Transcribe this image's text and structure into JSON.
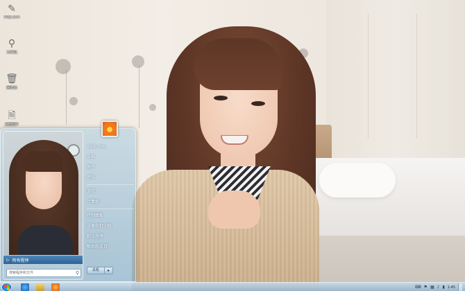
{
  "desktop": {
    "icons": [
      {
        "label": "Xieji.com",
        "icon": "pen-icon"
      },
      {
        "label": "计算机",
        "icon": "computer-icon"
      },
      {
        "label": "回收站",
        "icon": "recycle-bin-icon"
      },
      {
        "label": "桌面图片",
        "icon": "file-icon"
      }
    ]
  },
  "start_menu": {
    "all_programs_label": "所有程序",
    "search_placeholder": "搜索程序和文件",
    "right_items": [
      "Xieji.com",
      "文档",
      "图片",
      "音乐",
      "游戏",
      "计算机",
      "控制面板",
      "设备和打印机",
      "默认程序",
      "帮助和支持"
    ],
    "shutdown_label": "关机"
  },
  "taskbar": {
    "pinned": [
      "ie-icon",
      "explorer-icon",
      "media-player-icon"
    ],
    "tray": {
      "time": "1:45",
      "date": "2011/1/1"
    }
  },
  "colors": {
    "taskbar": "#a9c6dc",
    "all_programs_bar": "#2d6396",
    "start_orb": "#1d6fc1"
  }
}
